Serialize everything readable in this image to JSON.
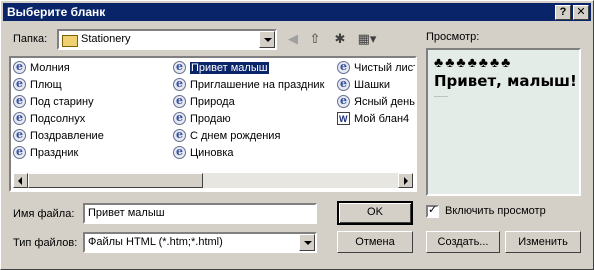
{
  "window": {
    "title": "Выберите бланк",
    "help_button": "?",
    "close_button": "✕"
  },
  "lookin": {
    "label": "Папка:",
    "value": "Stationery"
  },
  "toolbar": {
    "back_icon": "back-arrow-icon",
    "up_icon": "up-folder-icon",
    "new_folder_icon": "new-folder-icon",
    "views_icon": "views-menu-icon"
  },
  "files": {
    "col1": [
      "Молния",
      "Плющ",
      "Под старину",
      "Подсолнух",
      "Поздравление",
      "Праздник"
    ],
    "col2": [
      "Привет малыш",
      "Приглашение на праздник",
      "Природа",
      "Продаю",
      "С днем рождения",
      "Циновка"
    ],
    "col3": [
      "Чистый лист",
      "Шашки",
      "Ясный день",
      "Мой блан4"
    ],
    "selected": "Привет малыш"
  },
  "preview": {
    "label": "Просмотр:",
    "decoration": "♣♣♣♣♣♣♣",
    "headline": "Привет, малыш!"
  },
  "filename": {
    "label": "Имя файла:",
    "value": "Привет малыш"
  },
  "filetype": {
    "label": "Тип файлов:",
    "value": "Файлы HTML (*.htm;*.html)"
  },
  "buttons": {
    "ok": "OK",
    "cancel": "Отмена",
    "create": "Создать...",
    "modify": "Изменить"
  },
  "show_preview": {
    "label": "Включить просмотр",
    "checked": true
  }
}
